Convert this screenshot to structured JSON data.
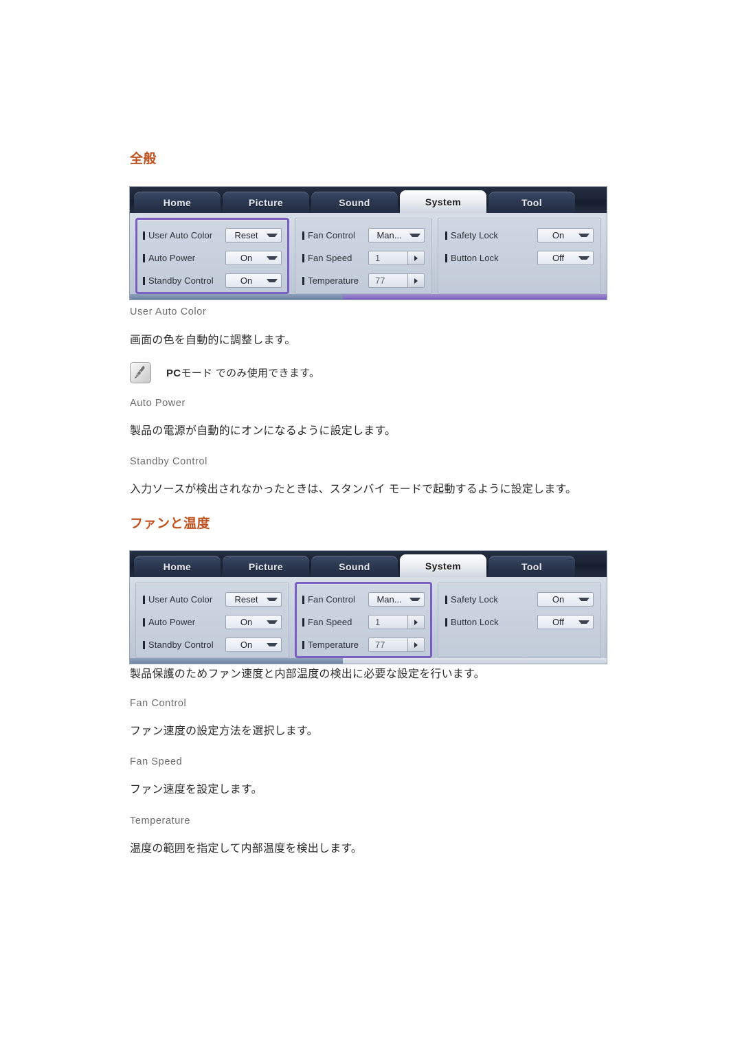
{
  "sections": [
    {
      "heading": "全般",
      "osd": {
        "tabs": [
          {
            "label": "Home",
            "active": false
          },
          {
            "label": "Picture",
            "active": false
          },
          {
            "label": "Sound",
            "active": false
          },
          {
            "label": "System",
            "active": true
          },
          {
            "label": "Tool",
            "active": false
          }
        ],
        "selected_group": 0,
        "groups": [
          {
            "rows": [
              {
                "label": "User Auto Color",
                "value": "Reset",
                "control": "select"
              },
              {
                "label": "Auto Power",
                "value": "On",
                "control": "select"
              },
              {
                "label": "Standby Control",
                "value": "On",
                "control": "select"
              }
            ]
          },
          {
            "rows": [
              {
                "label": "Fan Control",
                "value": "Man...",
                "control": "select"
              },
              {
                "label": "Fan Speed",
                "value": "1",
                "control": "spin"
              },
              {
                "label": "Temperature",
                "value": "77",
                "control": "spin"
              }
            ]
          },
          {
            "rows": [
              {
                "label": "Safety Lock",
                "value": "On",
                "control": "select"
              },
              {
                "label": "Button Lock",
                "value": "Off",
                "control": "select"
              }
            ]
          }
        ]
      },
      "items": [
        {
          "title": "User Auto Color",
          "text": "画面の色を自動的に調整します。"
        },
        {
          "note": "PCモード でのみ使用できます。",
          "note_prefix": "PC",
          "note_rest": "モード でのみ使用できます。"
        },
        {
          "title": "Auto Power",
          "text": "製品の電源が自動的にオンになるように設定します。"
        },
        {
          "title": "Standby Control",
          "text": "入力ソースが検出されなかったときは、スタンバイ モードで起動するように設定します。"
        }
      ]
    },
    {
      "heading": "ファンと温度",
      "osd": {
        "tabs": [
          {
            "label": "Home",
            "active": false
          },
          {
            "label": "Picture",
            "active": false
          },
          {
            "label": "Sound",
            "active": false
          },
          {
            "label": "System",
            "active": true
          },
          {
            "label": "Tool",
            "active": false
          }
        ],
        "selected_group": 1,
        "groups": [
          {
            "rows": [
              {
                "label": "User Auto Color",
                "value": "Reset",
                "control": "select"
              },
              {
                "label": "Auto Power",
                "value": "On",
                "control": "select"
              },
              {
                "label": "Standby Control",
                "value": "On",
                "control": "select"
              }
            ]
          },
          {
            "rows": [
              {
                "label": "Fan Control",
                "value": "Man...",
                "control": "select"
              },
              {
                "label": "Fan Speed",
                "value": "1",
                "control": "spin"
              },
              {
                "label": "Temperature",
                "value": "77",
                "control": "spin"
              }
            ]
          },
          {
            "rows": [
              {
                "label": "Safety Lock",
                "value": "On",
                "control": "select"
              },
              {
                "label": "Button Lock",
                "value": "Off",
                "control": "select"
              }
            ]
          }
        ]
      },
      "intro": "製品保護のためファン速度と内部温度の検出に必要な設定を行います。",
      "items": [
        {
          "title": "Fan Control",
          "text": "ファン速度の設定方法を選択します。"
        },
        {
          "title": "Fan Speed",
          "text": "ファン速度を設定します。"
        },
        {
          "title": "Temperature",
          "text": "温度の範囲を指定して内部温度を検出します。"
        }
      ]
    }
  ],
  "colors": {
    "heading": "#c0521f",
    "sub_heading": "#6c6c6c",
    "body": "#2a2a2a",
    "selection": "#7a5fc0",
    "tabbar": "#1b2334"
  },
  "icons": {
    "note": "note-pencil-icon",
    "caret_down": "chevron-down-icon",
    "caret_right": "chevron-right-icon"
  }
}
